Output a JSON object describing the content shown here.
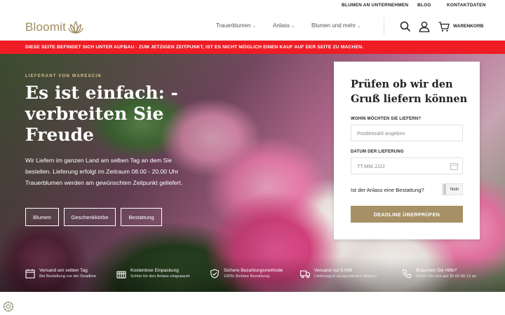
{
  "topbar": {
    "links": [
      "BLUMEN AN UNTERNEHMEN",
      "BLOG",
      "KONTAKTDATEN"
    ]
  },
  "header": {
    "logo_text": "Bloomit",
    "nav": [
      "Trauerblumen",
      "Anlass",
      "Blumen und mehr"
    ],
    "icons": [
      "search-icon",
      "user-icon",
      "cart-icon"
    ],
    "basket_label": "WARENKORB"
  },
  "notice": {
    "text": "DIESE SEITE BEFINDET SICH UNTER AUFBAU - ZUM JETZIGEN ZEITPUNKT, IST ES NICHT MÖGLICH EINEN KAUF AUF DER SEITE ZU MACHEN."
  },
  "hero": {
    "eyebrow": "LIEFERANT VON WARESCIN",
    "title": "Es ist einfach: - verbreiten Sie Freude",
    "text": "Wir Liefern im ganzen Land am selben Tag an dem Sie bestellen. Lieferung erfolgt im Zeitraum 08.00 - 20.00 Uhr Trauerblumen werden am gewünschten Zeitpunkt geliefert.",
    "buttons": [
      "Blumen",
      "Geschenkkörbe",
      "Bestattung"
    ]
  },
  "features": [
    {
      "icon": "calendar-icon",
      "title": "Versand am selben Tag",
      "subtitle": "Bei Bestellung vor der Deadline"
    },
    {
      "icon": "gift-icon",
      "title": "Kostenlose Einpackung",
      "subtitle": "Schön für den Anlass eingepackt"
    },
    {
      "icon": "shield-icon",
      "title": "Sichere Bezahlungsmethode",
      "subtitle": "100% Sichere Bezahlung"
    },
    {
      "icon": "truck-icon",
      "title": "Versand nur 6.00€",
      "subtitle": "Lieferung in ausgewählten Städten"
    },
    {
      "icon": "phone-icon",
      "title": "Brauchen Sie Hilfe?",
      "subtitle": "Rufen Sie uns auf 35 65 80 12 an"
    }
  ],
  "card": {
    "title": "Prüfen ob wir den Gruß liefern können",
    "postcode_label": "WOHIN MÖCHTEN SIE LIEFERN?",
    "postcode_placeholder": "Postleitzahl angeben",
    "date_label": "DATUM DER LIEFERUNG",
    "date_placeholder": "TT.MM.JJJJ",
    "question": "Ist der Anlass eine Bestattung?",
    "toggle_value": "Nein",
    "cta": "DEADLINE ÜBERPRÜFEN"
  },
  "colors": {
    "brand_gold": "#a69065",
    "notice_red": "#ee1c24"
  }
}
